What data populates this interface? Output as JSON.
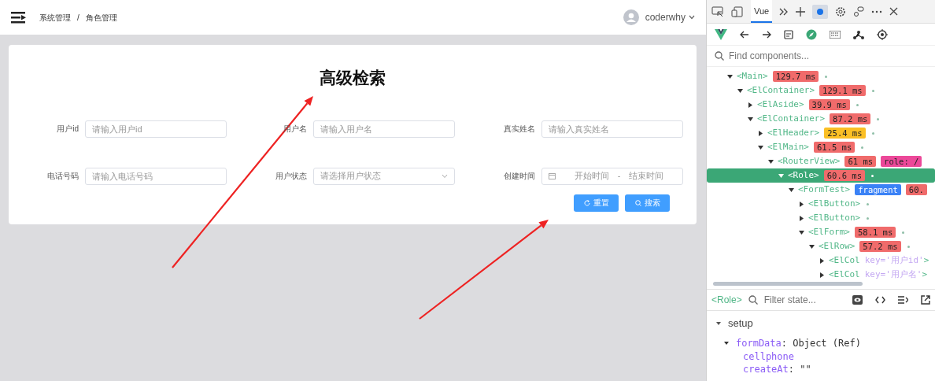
{
  "header": {
    "breadcrumb": [
      "系统管理",
      "/",
      "角色管理"
    ],
    "user": "coderwhy"
  },
  "search_form": {
    "title": "高级检索",
    "fields": [
      {
        "kind": "input",
        "label": "用户id",
        "placeholder": "请输入用户id"
      },
      {
        "kind": "input",
        "label": "用户名",
        "placeholder": "请输入用户名"
      },
      {
        "kind": "input",
        "label": "真实姓名",
        "placeholder": "请输入真实姓名"
      },
      {
        "kind": "input",
        "label": "电话号码",
        "placeholder": "请输入电话号码"
      },
      {
        "kind": "select",
        "label": "用户状态",
        "placeholder": "请选择用户状态"
      },
      {
        "kind": "daterange",
        "label": "创建时间",
        "start_placeholder": "开始时间",
        "separator": "-",
        "end_placeholder": "结束时间"
      }
    ],
    "buttons": [
      {
        "kind": "reset",
        "label": "重置"
      },
      {
        "kind": "search",
        "label": "搜索"
      }
    ]
  },
  "annotations": [
    {
      "kind": "arrow"
    },
    {
      "kind": "arrow"
    }
  ],
  "devtools": {
    "tabs": [
      {
        "label": "Vue",
        "selected": true
      }
    ],
    "search": {
      "placeholder": "Find components..."
    },
    "tree": [
      {
        "tag": "<Main>",
        "expanded": true,
        "selected": false,
        "dot": true,
        "badges": [
          {
            "text": "129.7 ms",
            "color": "#f06b6b"
          }
        ],
        "children": [
          {
            "tag": "<ElContainer>",
            "expanded": true,
            "selected": false,
            "dot": true,
            "badges": [
              {
                "text": "129.1 ms",
                "color": "#f06b6b"
              }
            ],
            "children": [
              {
                "tag": "<ElAside>",
                "expanded": false,
                "selected": false,
                "dot": true,
                "badges": [
                  {
                    "text": "39.9 ms",
                    "color": "#f06b6b"
                  }
                ]
              },
              {
                "tag": "<ElContainer>",
                "expanded": true,
                "selected": false,
                "dot": true,
                "badges": [
                  {
                    "text": "87.2 ms",
                    "color": "#f06b6b"
                  }
                ],
                "children": [
                  {
                    "tag": "<ElHeader>",
                    "expanded": false,
                    "selected": false,
                    "dot": true,
                    "badges": [
                      {
                        "text": "25.4 ms",
                        "color": "#fbbf24"
                      }
                    ]
                  },
                  {
                    "tag": "<ElMain>",
                    "expanded": true,
                    "selected": false,
                    "dot": true,
                    "badges": [
                      {
                        "text": "61.5 ms",
                        "color": "#f06b6b"
                      }
                    ],
                    "children": [
                      {
                        "tag": "<RouterView>",
                        "expanded": true,
                        "selected": false,
                        "dot": false,
                        "badges": [
                          {
                            "text": "61 ms",
                            "color": "#f06b6b"
                          },
                          {
                            "text": "role: /",
                            "color": "#ec4899"
                          }
                        ],
                        "children": [
                          {
                            "tag": "<Role>",
                            "expanded": true,
                            "selected": true,
                            "dot": true,
                            "badges": [
                              {
                                "text": "60.6 ms",
                                "color": "#f06b6b"
                              }
                            ],
                            "children": [
                              {
                                "tag": "<FormTest>",
                                "expanded": true,
                                "selected": false,
                                "dot": false,
                                "badges": [
                                  {
                                    "text": "fragment",
                                    "color": "#3b82f6"
                                  },
                                  {
                                    "text": "60.",
                                    "color": "#f06b6b"
                                  }
                                ],
                                "children": [
                                  {
                                    "tag": "<ElButton>",
                                    "expanded": false,
                                    "selected": false,
                                    "dot": true
                                  },
                                  {
                                    "tag": "<ElButton>",
                                    "expanded": false,
                                    "selected": false,
                                    "dot": true
                                  },
                                  {
                                    "tag": "<ElForm>",
                                    "expanded": true,
                                    "selected": false,
                                    "dot": true,
                                    "badges": [
                                      {
                                        "text": "58.1 ms",
                                        "color": "#f06b6b"
                                      }
                                    ],
                                    "children": [
                                      {
                                        "tag": "<ElRow>",
                                        "expanded": true,
                                        "selected": false,
                                        "dot": true,
                                        "badges": [
                                          {
                                            "text": "57.2 ms",
                                            "color": "#f06b6b"
                                          }
                                        ],
                                        "children": [
                                          {
                                            "tag": "<ElCol",
                                            "attr": "key='用户id'",
                                            "tag_end": ">",
                                            "expanded": false,
                                            "selected": false,
                                            "dot": false
                                          },
                                          {
                                            "tag": "<ElCol",
                                            "attr": "key='用户名'",
                                            "tag_end": ">",
                                            "expanded": false,
                                            "selected": false,
                                            "dot": false
                                          }
                                        ]
                                      }
                                    ]
                                  }
                                ]
                              }
                            ]
                          }
                        ]
                      }
                    ]
                  }
                ]
              }
            ]
          }
        ]
      }
    ],
    "state": {
      "component": "<Role>",
      "filter_placeholder": "Filter state...",
      "sections": [
        {
          "title": "setup",
          "expanded": true,
          "items": [
            {
              "key": "formData",
              "value": ": Object (Ref)",
              "expanded": true,
              "children": [
                {
                  "key": "cellphone"
                },
                {
                  "key": "createAt",
                  "value": ": \"\""
                }
              ]
            }
          ]
        }
      ]
    }
  }
}
